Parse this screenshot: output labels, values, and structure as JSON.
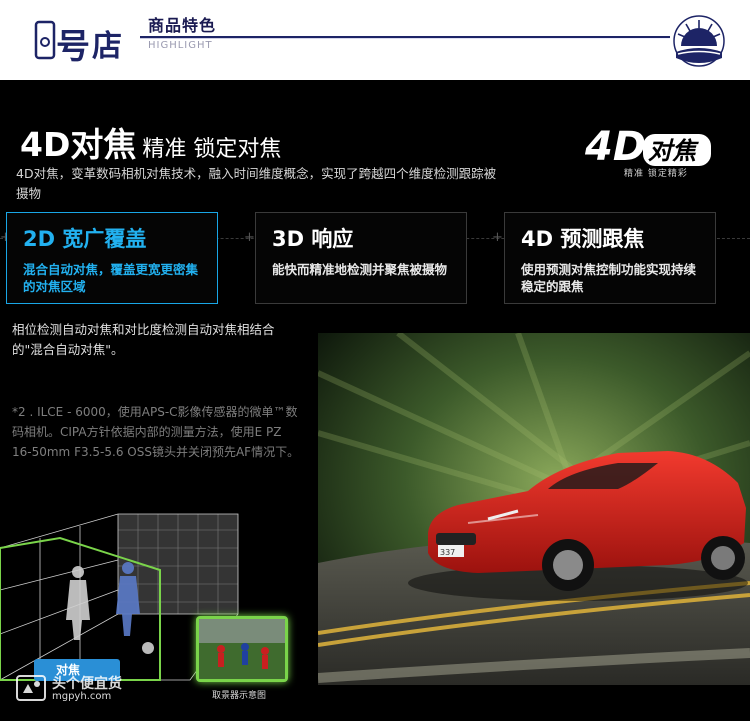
{
  "header": {
    "title": "商品特色",
    "subtitle": "HIGHLIGHT"
  },
  "main": {
    "title_big": "4D对焦",
    "title_small": "精准 锁定对焦",
    "intro": "4D对焦，变革数码相机对焦技术，融入时间维度概念，实现了跨越四个维度检测跟踪被摄物",
    "badge_text": "4D对焦",
    "badge_sub": "精准 锁定精彩"
  },
  "features": [
    {
      "title": "2D 宽广覆盖",
      "desc": "混合自动对焦，覆盖更宽更密集的对焦区域",
      "active": true
    },
    {
      "title": "3D 响应",
      "desc": "能快而精准地检测并聚焦被摄物",
      "active": false
    },
    {
      "title": "4D 预测跟焦",
      "desc": "使用预测对焦控制功能实现持续稳定的跟焦",
      "active": false
    }
  ],
  "notes": {
    "main": "相位检测自动对焦和对比度检测自动对焦相结合的\"混合自动对焦\"。",
    "small": "*2 . ILCE - 6000，使用APS-C影像传感器的微单™数码相机。CIPA方针依据内部的测量方法，使用E PZ 16-50mm F3.5-5.6 OSS镜头并关闭预先AF情况下。"
  },
  "illustration": {
    "focus_button": "对焦",
    "finder_caption": "取景器示意图"
  },
  "photo": {
    "plate": "337"
  },
  "watermark": {
    "name": "头个便宜货",
    "url": "mgpyh.com"
  },
  "colors": {
    "accent": "#22b1f0",
    "header_navy": "#1d2466",
    "finder_green": "#7ad44a",
    "car_red": "#d8211c"
  }
}
